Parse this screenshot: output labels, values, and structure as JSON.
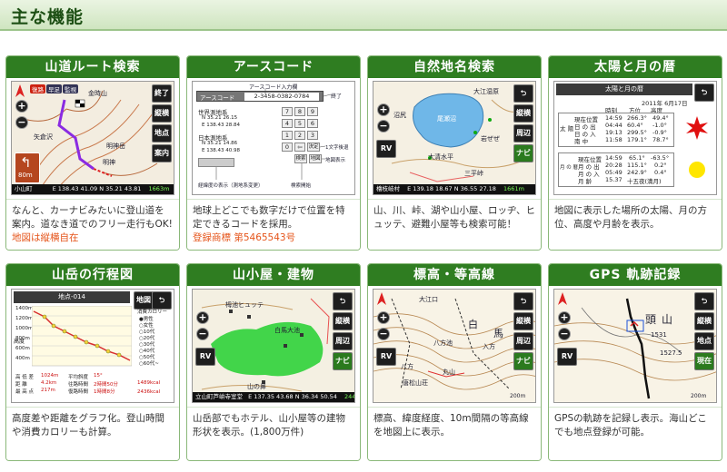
{
  "page": {
    "title": "主な機能"
  },
  "cards": [
    {
      "heading": "山道ルート検索",
      "text": "なんと、カーナビみたいに登山道を案内。道なき道でのフリー走行もOK!",
      "note": "地図は縦横自在",
      "screen": {
        "tags": [
          "復路",
          "早足",
          "監視"
        ],
        "buttons": [
          "終了",
          "縦横",
          "地点",
          "案内"
        ],
        "labels": [
          "金時山",
          "矢倉沢",
          "明神岳",
          "明神"
        ],
        "sign": "80m",
        "status_left": "小山町",
        "status_center": "E 138.43 41.09   N 35.21 43.81",
        "status_right": "1663m"
      }
    },
    {
      "heading": "アースコード",
      "text": "地球上どこでも数字だけで位置を特定できるコードを採用。",
      "note": "登録商標 第5465543号",
      "screen": {
        "top_label": "アースコード入力欄",
        "field_label": "アースコード",
        "code": "2-3458-0382-0784",
        "end_label": "終了",
        "world_label": "世界測地系",
        "world_n": "N 35.21 26.15",
        "world_e": "E 138.43 28.84",
        "japan_label": "日本測地系",
        "japan_n": "N 35.21 14.86",
        "japan_e": "E 138.43 40.98",
        "keys": [
          "7",
          "8",
          "9",
          "4",
          "5",
          "6",
          "1",
          "2",
          "3",
          "0",
          "⇦",
          "決定"
        ],
        "erase_label": "1文字後退",
        "map_label": "地図表示",
        "bottom_left": "経緯度の表示（測地系変更）",
        "bottom_right": "検索開始",
        "btn1": "検索",
        "btn2": "地図"
      }
    },
    {
      "heading": "自然地名検索",
      "text": "山、川、峠、湖や山小屋、ロッヂ、ヒュッテ、避難小屋等も検索可能！",
      "note": "",
      "screen": {
        "buttons": [
          "⮌",
          "縦横",
          "周辺",
          "ナビ"
        ],
        "rv": "RV",
        "lake": "尾瀬沼",
        "labels": [
          "大江湿原",
          "沼尻",
          "大清水平",
          "三平峠",
          "岩ぜぜ"
        ],
        "status_left": "檜枝岐村",
        "status_center": "E 139.18 18.67   N 36.55 27.18",
        "status_right": "1661m"
      }
    },
    {
      "heading": "太陽と月の暦",
      "text": "地図に表示した場所の太陽、月の方位、高度や月齢を表示。",
      "note": "",
      "screen": {
        "title": "太陽と月の暦",
        "date": "2011年 6月17日",
        "headers": [
          "時刻",
          "方位",
          "高度"
        ],
        "sun_rows": [
          [
            "太 陽",
            "現在位置",
            "14:59",
            "266.3°",
            "49.4°"
          ],
          [
            "",
            "日 の 出",
            "04:44",
            "60.4°",
            "-1.0°"
          ],
          [
            "",
            "日 の 入",
            "19:13",
            "299.5°",
            "-0.9°"
          ],
          [
            "",
            "南 中",
            "11:58",
            "179.1°",
            "78.7°"
          ]
        ],
        "moon_rows": [
          [
            "月 の 暦",
            "現在位置",
            "14:59",
            "65.1°",
            "-63.5°"
          ],
          [
            "",
            "月 の 出",
            "20:28",
            "115.1°",
            "0.2°"
          ],
          [
            "",
            "月 の 入",
            "05:49",
            "242.9°",
            "0.4°"
          ],
          [
            "",
            "月 齢",
            "15.37",
            "十五夜(満月)",
            ""
          ]
        ]
      }
    },
    {
      "heading": "山岳の行程図",
      "text": "高度差や距離をグラフ化。登山時間や消費カロリーも計算。",
      "note": "",
      "screen": {
        "title": "地点-014",
        "btn_map": "地図",
        "btn_back": "⮌",
        "y_ticks": [
          "1400m",
          "1200m",
          "1000m",
          "800m",
          "600m",
          "400m"
        ],
        "y_axis_label": "高度",
        "cal_title": "消費カロリー",
        "cal_items": [
          "●男性",
          "○女性",
          "○10代",
          "○20代",
          "○30代",
          "○40代",
          "○50代",
          "○60代~"
        ],
        "rows": [
          [
            "高 低 差",
            "1024m",
            "平均斜度",
            "15°",
            "1489kcal"
          ],
          [
            "距 離",
            "4.2km",
            "往路時間",
            "2時間50分",
            ""
          ],
          [
            "最 高 点",
            "217m",
            "復路時間",
            "1時間8分",
            "2436kcal"
          ]
        ]
      }
    },
    {
      "heading": "山小屋・建物",
      "text": "山岳部でもホテル、山小屋等の建物形状を表示。(1,800万件)",
      "note": "",
      "screen": {
        "buttons": [
          "⮌",
          "縦横",
          "周辺",
          "ナビ"
        ],
        "rv": "RV",
        "labels": [
          "栂池ヒュッテ",
          "白馬大池",
          "山の鼻"
        ],
        "status_left": "立山町芦峅寺室堂",
        "status_center": "E 137.35 43.68   N 36.34 50.54",
        "status_right": "2448m"
      }
    },
    {
      "heading": "標高・等高線",
      "text": "標高、緯度経度、10m間隔の等高線を地図上に表示。",
      "note": "",
      "screen": {
        "buttons": [
          "⮌",
          "縦横",
          "周辺",
          "ナビ"
        ],
        "rv": "RV",
        "labels": [
          "大江口",
          "白",
          "馬",
          "八方池",
          "八方",
          "唐松山荘",
          "丸山",
          "入方"
        ],
        "scale": "200m"
      }
    },
    {
      "heading": "GPS 軌跡記録",
      "text": "GPSの軌跡を記録し表示。海山どこでも地点登録が可能。",
      "note": "",
      "screen": {
        "buttons": [
          "⮌",
          "縦横",
          "地点",
          "現在"
        ],
        "rv": "RV",
        "labels": [
          "頭",
          "山",
          "1531",
          "1527.5"
        ],
        "scale": "200m"
      }
    }
  ]
}
